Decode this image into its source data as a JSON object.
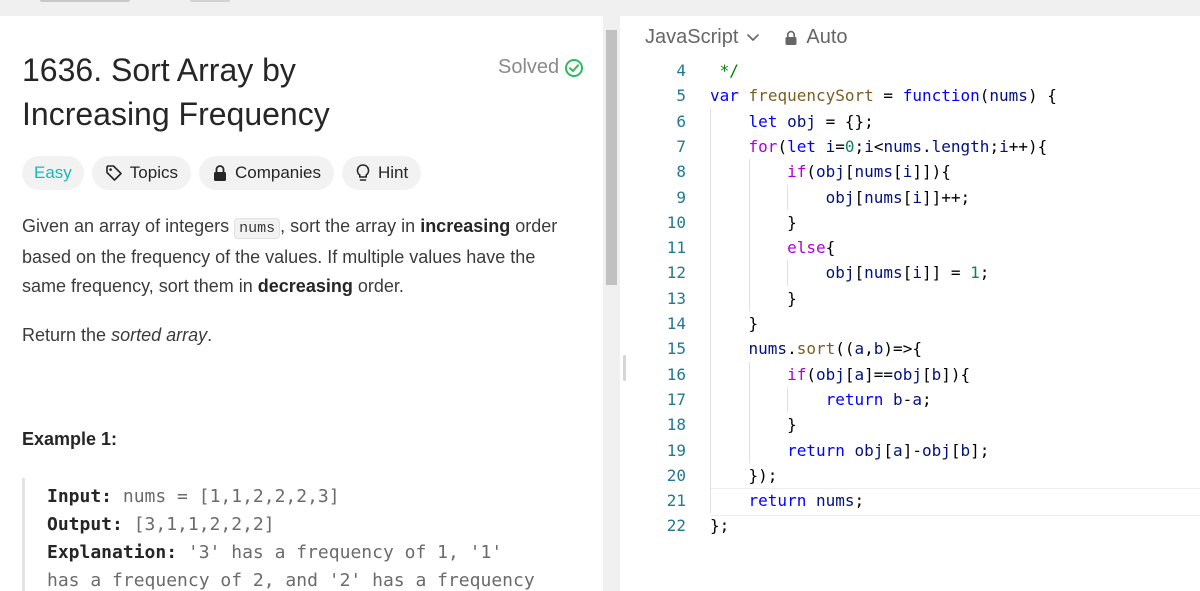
{
  "problem": {
    "title": "1636. Sort Array by Increasing Frequency",
    "status": "Solved",
    "tags": {
      "difficulty": "Easy",
      "topics": "Topics",
      "companies": "Companies",
      "hint": "Hint"
    },
    "description": {
      "p1_a": "Given an array of integers ",
      "p1_code": "nums",
      "p1_b": ", sort the array in ",
      "p1_bold1": "increasing",
      "p1_c": " order based on the frequency of the values. If multiple values have the same frequency, sort them in ",
      "p1_bold2": "decreasing",
      "p1_d": " order.",
      "p2_a": "Return the ",
      "p2_italic": "sorted array",
      "p2_b": "."
    },
    "example": {
      "heading": "Example 1:",
      "input_label": "Input:",
      "input_value": " nums = [1,1,2,2,2,3]",
      "output_label": "Output:",
      "output_value": " [3,1,1,2,2,2]",
      "explanation_label": "Explanation:",
      "explanation_value": " '3' has a frequency of 1, '1'",
      "explanation_cont": "has a frequency of 2, and '2' has a frequency"
    }
  },
  "editor": {
    "language": "JavaScript",
    "mode": "Auto",
    "lines": [
      {
        "n": "4",
        "text": " */"
      },
      {
        "n": "5",
        "text": "var frequencySort = function(nums) {"
      },
      {
        "n": "6",
        "text": "    let obj = {};"
      },
      {
        "n": "7",
        "text": "    for(let i=0;i<nums.length;i++){"
      },
      {
        "n": "8",
        "text": "        if(obj[nums[i]]){"
      },
      {
        "n": "9",
        "text": "            obj[nums[i]]++;"
      },
      {
        "n": "10",
        "text": "        }"
      },
      {
        "n": "11",
        "text": "        else{"
      },
      {
        "n": "12",
        "text": "            obj[nums[i]] = 1;"
      },
      {
        "n": "13",
        "text": "        }"
      },
      {
        "n": "14",
        "text": "    }"
      },
      {
        "n": "15",
        "text": "    nums.sort((a,b)=>{"
      },
      {
        "n": "16",
        "text": "        if(obj[a]==obj[b]){"
      },
      {
        "n": "17",
        "text": "            return b-a;"
      },
      {
        "n": "18",
        "text": "        }"
      },
      {
        "n": "19",
        "text": "        return obj[a]-obj[b];"
      },
      {
        "n": "20",
        "text": "    });"
      },
      {
        "n": "21",
        "text": "    return nums;"
      },
      {
        "n": "22",
        "text": "};"
      }
    ]
  }
}
